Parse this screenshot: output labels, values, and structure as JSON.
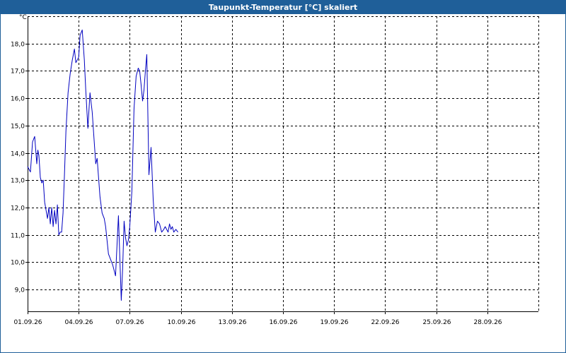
{
  "window": {
    "title": "Taupunkt-Temperatur [°C] skaliert"
  },
  "chart_data": {
    "type": "line",
    "title": "Taupunkt-Temperatur [°C] skaliert",
    "ylabel": "°C",
    "xlabel": "",
    "xlim": [
      "01.09.26",
      "01.10.26"
    ],
    "ylim": [
      8.2,
      19.0
    ],
    "grid": true,
    "line_color": "#0000c0",
    "y_ticks": [
      9.0,
      10.0,
      11.0,
      12.0,
      13.0,
      14.0,
      15.0,
      16.0,
      17.0,
      18.0
    ],
    "y_tick_labels": [
      "9,0",
      "10,0",
      "11,0",
      "12,0",
      "13,0",
      "14,0",
      "15,0",
      "16,0",
      "17,0",
      "18,0"
    ],
    "x_ticks": [
      "01.09.26",
      "04.09.26",
      "07.09.26",
      "10.09.26",
      "13.09.26",
      "16.09.26",
      "19.09.26",
      "22.09.26",
      "25.09.26",
      "28.09.26"
    ],
    "series": [
      {
        "x": [
          "01.09.26 00:00",
          "01.09.26 04:00",
          "01.09.26 07:00",
          "01.09.26 10:00",
          "01.09.26 13:00",
          "01.09.26 14:30",
          "01.09.26 16:00",
          "01.09.26 18:00",
          "01.09.26 20:00",
          "01.09.26 22:00",
          "02.09.26 00:00",
          "02.09.26 02:00",
          "02.09.26 04:00",
          "02.09.26 06:00",
          "02.09.26 08:00",
          "02.09.26 10:00",
          "02.09.26 12:00",
          "02.09.26 14:00",
          "02.09.26 16:00",
          "02.09.26 18:00",
          "02.09.26 20:00",
          "02.09.26 22:00",
          "03.09.26 00:00",
          "03.09.26 02:00",
          "03.09.26 04:00",
          "03.09.26 06:00",
          "03.09.26 09:00",
          "03.09.26 12:00",
          "03.09.26 15:00",
          "03.09.26 18:00",
          "03.09.26 20:00",
          "04.09.26 00:00",
          "04.09.26 02:00",
          "04.09.26 05:00",
          "04.09.26 08:00",
          "04.09.26 10:00",
          "04.09.26 13:00",
          "04.09.26 16:00",
          "04.09.26 19:00",
          "05.09.26 00:00",
          "05.09.26 02:00",
          "05.09.26 04:00",
          "05.09.26 06:00",
          "05.09.26 09:00",
          "05.09.26 12:00",
          "05.09.26 14:00",
          "05.09.26 16:00",
          "05.09.26 18:00",
          "06.09.26 00:00",
          "06.09.26 04:00",
          "06.09.26 08:00",
          "06.09.26 12:00",
          "06.09.26 14:00",
          "06.09.26 16:00",
          "06.09.26 18:00",
          "06.09.26 20:00",
          "06.09.26 22:00",
          "07.09.26 00:00",
          "07.09.26 03:00",
          "07.09.26 06:00",
          "07.09.26 09:00",
          "07.09.26 12:00",
          "07.09.26 14:00",
          "07.09.26 16:00",
          "07.09.26 18:00",
          "07.09.26 20:00",
          "07.09.26 22:00",
          "08.09.26 00:00",
          "08.09.26 03:00",
          "08.09.26 06:00",
          "08.09.26 09:00",
          "08.09.26 12:00",
          "08.09.26 15:00",
          "08.09.26 18:00",
          "08.09.26 21:00",
          "09.09.26 00:00",
          "09.09.26 02:00",
          "09.09.26 04:00",
          "09.09.26 06:00",
          "09.09.26 08:00",
          "09.09.26 10:00",
          "09.09.26 12:00",
          "09.09.26 14:00",
          "09.09.26 17:00",
          "09.09.26 20:00"
        ],
        "y": [
          13.5,
          13.3,
          14.4,
          14.6,
          13.6,
          14.1,
          13.9,
          13.1,
          12.9,
          13.0,
          12.2,
          11.9,
          11.6,
          12.0,
          11.4,
          12.0,
          11.3,
          11.9,
          11.4,
          12.1,
          11.0,
          11.1,
          11.1,
          11.8,
          13.2,
          14.8,
          16.2,
          16.9,
          17.4,
          17.8,
          17.3,
          17.5,
          18.3,
          18.5,
          17.4,
          16.3,
          14.9,
          16.2,
          15.5,
          13.6,
          13.8,
          13.1,
          12.4,
          11.8,
          11.6,
          11.3,
          10.8,
          10.3,
          9.9,
          9.5,
          11.7,
          8.6,
          9.8,
          11.5,
          10.9,
          10.6,
          10.8,
          11.3,
          12.6,
          15.6,
          16.8,
          17.1,
          17.0,
          16.5,
          15.9,
          16.3,
          17.0,
          17.6,
          13.2,
          14.2,
          12.3,
          11.1,
          11.5,
          11.4,
          11.1,
          11.2,
          11.3,
          11.2,
          11.1,
          11.4,
          11.2,
          11.3,
          11.1,
          11.2,
          11.1
        ]
      }
    ]
  }
}
